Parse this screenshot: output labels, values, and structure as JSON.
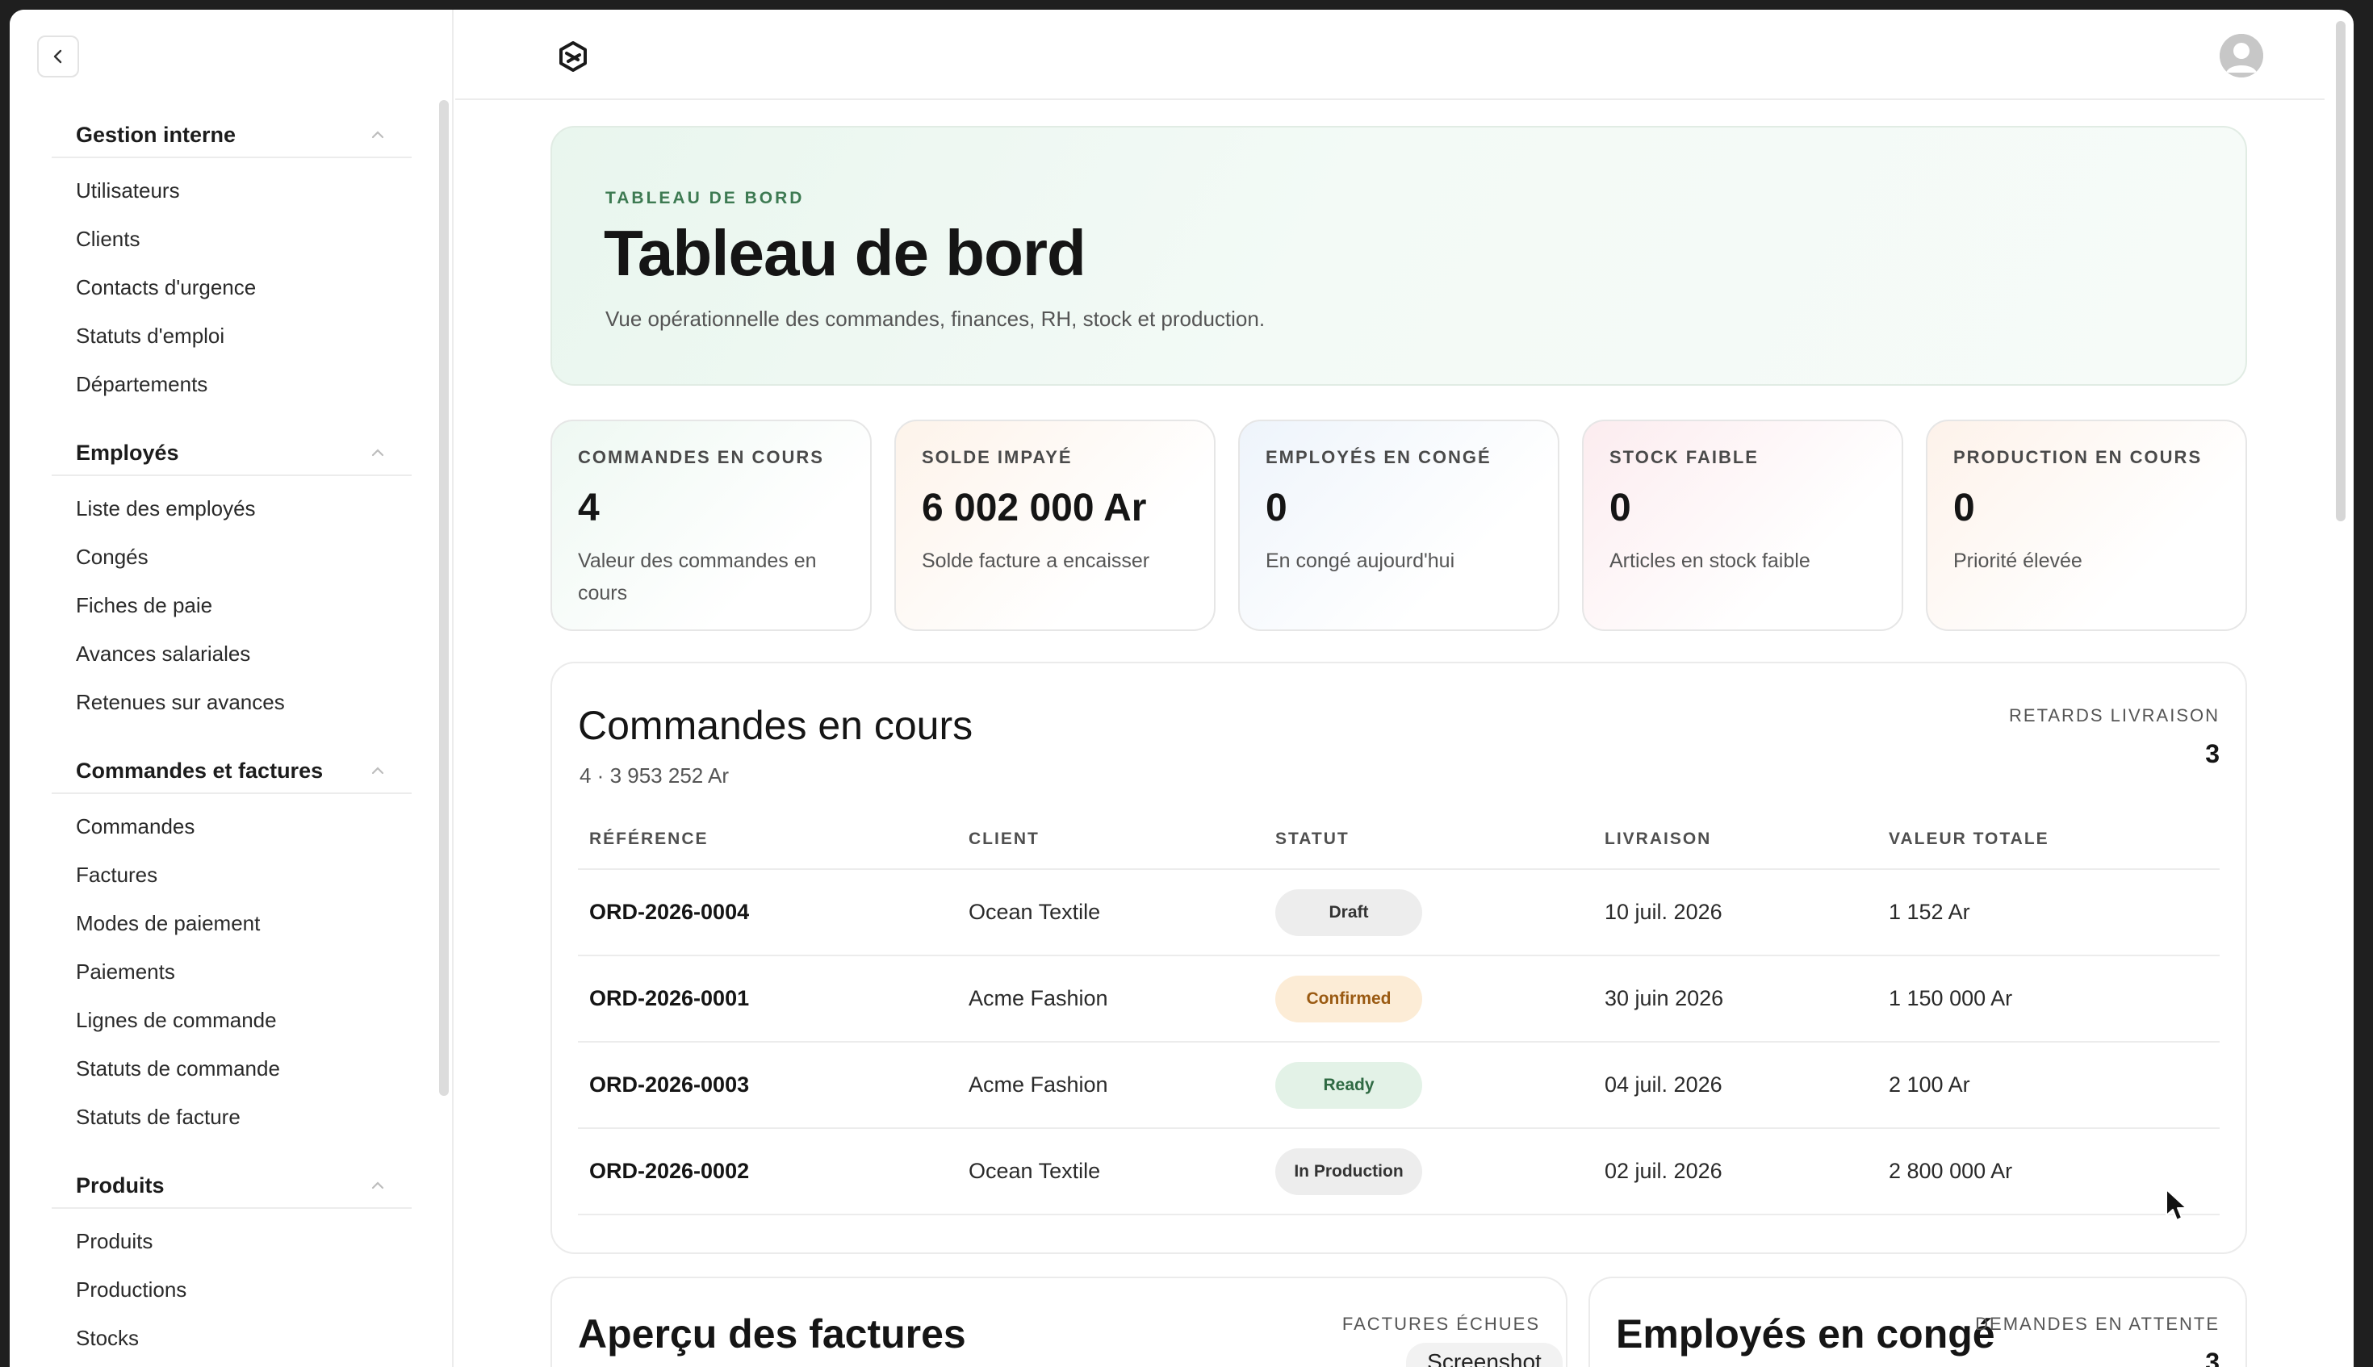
{
  "sidebar": {
    "groups": [
      {
        "title": "Gestion interne",
        "items": [
          "Utilisateurs",
          "Clients",
          "Contacts d'urgence",
          "Statuts d'emploi",
          "Départements"
        ]
      },
      {
        "title": "Employés",
        "items": [
          "Liste des employés",
          "Congés",
          "Fiches de paie",
          "Avances salariales",
          "Retenues sur avances"
        ]
      },
      {
        "title": "Commandes et factures",
        "items": [
          "Commandes",
          "Factures",
          "Modes de paiement",
          "Paiements",
          "Lignes de commande",
          "Statuts de commande",
          "Statuts de facture"
        ]
      },
      {
        "title": "Produits",
        "items": [
          "Produits",
          "Productions",
          "Stocks"
        ]
      }
    ]
  },
  "hero": {
    "eyebrow": "TABLEAU DE BORD",
    "title": "Tableau de bord",
    "subtitle": "Vue opérationnelle des commandes, finances, RH, stock et production."
  },
  "kpis": [
    {
      "label": "COMMANDES EN COURS",
      "value": "4",
      "note": "Valeur des commandes en cours",
      "tint": "#eef8f2"
    },
    {
      "label": "SOLDE IMPAYÉ",
      "value": "6 002 000 Ar",
      "note": "Solde facture a encaisser",
      "tint": "#fdf3ea"
    },
    {
      "label": "EMPLOYÉS EN CONGÉ",
      "value": "0",
      "note": "En congé aujourd'hui",
      "tint": "#eef4fb"
    },
    {
      "label": "STOCK FAIBLE",
      "value": "0",
      "note": "Articles en stock faible",
      "tint": "#fcecef"
    },
    {
      "label": "PRODUCTION EN COURS",
      "value": "0",
      "note": "Priorité élevée",
      "tint": "#fdf2ea"
    }
  ],
  "orders": {
    "title": "Commandes en cours",
    "subtitle": "4 · 3 953 252 Ar",
    "delay_label": "RETARDS LIVRAISON",
    "delay_value": "3",
    "columns": [
      "RÉFÉRENCE",
      "CLIENT",
      "STATUT",
      "LIVRAISON",
      "VALEUR TOTALE"
    ],
    "rows": [
      {
        "ref": "ORD-2026-0004",
        "client": "Ocean Textile",
        "status": "Draft",
        "status_bg": "#ededed",
        "status_fg": "#333333",
        "delivery": "10 juil. 2026",
        "total": "1 152 Ar"
      },
      {
        "ref": "ORD-2026-0001",
        "client": "Acme Fashion",
        "status": "Confirmed",
        "status_bg": "#fcecd6",
        "status_fg": "#9a5a12",
        "delivery": "30 juin 2026",
        "total": "1 150 000 Ar"
      },
      {
        "ref": "ORD-2026-0003",
        "client": "Acme Fashion",
        "status": "Ready",
        "status_bg": "#e3f2e7",
        "status_fg": "#2f6a43",
        "delivery": "04 juil. 2026",
        "total": "2 100 Ar"
      },
      {
        "ref": "ORD-2026-0002",
        "client": "Ocean Textile",
        "status": "In Production",
        "status_bg": "#ededed",
        "status_fg": "#333333",
        "delivery": "02 juil. 2026",
        "total": "2 800 000 Ar"
      }
    ]
  },
  "invoices": {
    "title": "Aperçu des factures",
    "side_label": "FACTURES ÉCHUES"
  },
  "leave": {
    "title": "Employés en congé",
    "side_label": "DEMANDES EN ATTENTE",
    "side_value": "3"
  },
  "tooltip": "Screenshot"
}
